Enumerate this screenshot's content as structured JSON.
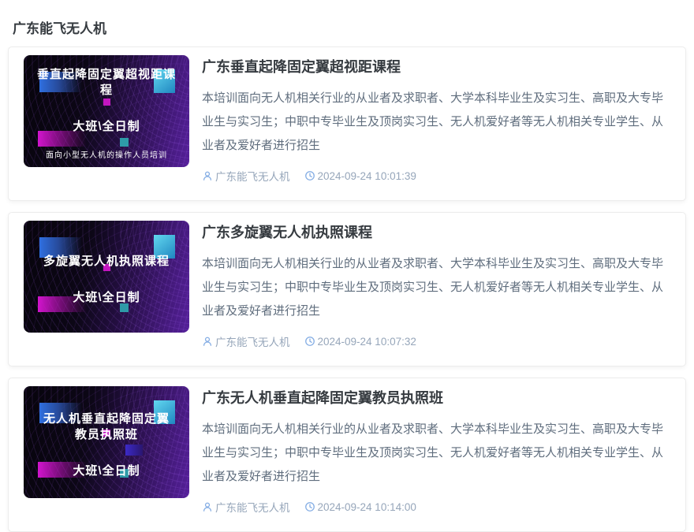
{
  "page": {
    "title": "广东能飞无人机"
  },
  "colors": {
    "card_border": "#ececec",
    "title_text": "#363b40",
    "description_text": "#5f6d7d",
    "meta_text": "#96a6ba",
    "meta_icon": "#84ade4",
    "thumb_bg_purple": "#55209a",
    "thumb_blue": "#2f6fe0",
    "thumb_cyan": "#62d8f0",
    "thumb_magenta": "#d214cd"
  },
  "icons": {
    "author": "person-icon",
    "time": "clock-icon"
  },
  "cards": [
    {
      "thumb": {
        "title": "垂直起降固定翼超视距课程",
        "subtitle": "大班\\全日制",
        "caption": "面向小型无人机的操作人员培训"
      },
      "title": "广东垂直起降固定翼超视距课程",
      "description": "本培训面向无人机相关行业的从业者及求职者、大学本科毕业生及实习生、高职及大专毕业生与实习生；中职中专毕业生及顶岗实习生、无人机爱好者等无人机相关专业学生、从业者及爱好者进行招生",
      "author": "广东能飞无人机",
      "datetime": "2024-09-24 10:01:39"
    },
    {
      "thumb": {
        "title": "多旋翼无人机执照课程",
        "subtitle": "大班\\全日制"
      },
      "title": "广东多旋翼无人机执照课程",
      "description": "本培训面向无人机相关行业的从业者及求职者、大学本科毕业生及实习生、高职及大专毕业生与实习生；中职中专毕业生及顶岗实习生、无人机爱好者等无人机相关专业学生、从业者及爱好者进行招生",
      "author": "广东能飞无人机",
      "datetime": "2024-09-24 10:07:32"
    },
    {
      "thumb": {
        "title": "无人机垂直起降固定翼教员执照班",
        "subtitle": "大班\\全日制"
      },
      "title": "广东无人机垂直起降固定翼教员执照班",
      "description": "本培训面向无人机相关行业的从业者及求职者、大学本科毕业生及实习生、高职及大专毕业生与实习生；中职中专毕业生及顶岗实习生、无人机爱好者等无人机相关专业学生、从业者及爱好者进行招生",
      "author": "广东能飞无人机",
      "datetime": "2024-09-24 10:14:00"
    }
  ]
}
